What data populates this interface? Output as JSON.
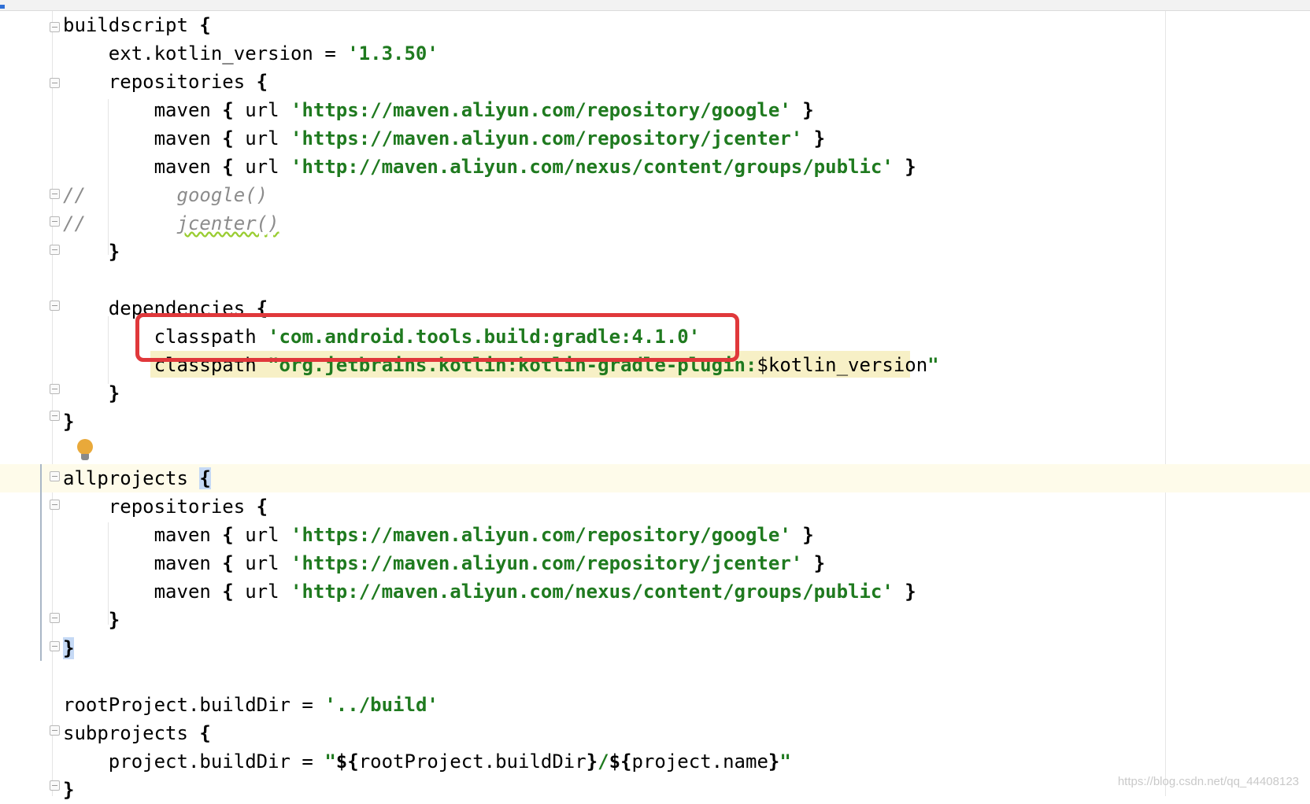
{
  "editor": {
    "lines": [
      {
        "id": "l1",
        "t1": "buildscript ",
        "b": "{"
      },
      {
        "id": "l2",
        "t1": "    ext.kotlin_version = ",
        "s": "'1.3.50'"
      },
      {
        "id": "l3",
        "t1": "    repositories ",
        "b": "{"
      },
      {
        "id": "l4",
        "t1": "        maven ",
        "b1": "{",
        "t2": " url ",
        "s": "'https://maven.aliyun.com/repository/google'",
        "b2": "}"
      },
      {
        "id": "l5",
        "t1": "        maven ",
        "b1": "{",
        "t2": " url ",
        "s": "'https://maven.aliyun.com/repository/jcenter'",
        "b2": "}"
      },
      {
        "id": "l6",
        "t1": "        maven ",
        "b1": "{",
        "t2": " url ",
        "s": "'http://maven.aliyun.com/nexus/content/groups/public'",
        "b2": "}"
      },
      {
        "id": "l7",
        "c1": "//",
        "c2": "google()"
      },
      {
        "id": "l8",
        "c1": "//",
        "c2": "jcenter()"
      },
      {
        "id": "l9",
        "t1": "    ",
        "b": "}"
      },
      {
        "id": "l10",
        "t1": "    dependencies ",
        "b": "{"
      },
      {
        "id": "l11",
        "t1": "        classpath ",
        "s": "'com.android.tools.build:gradle:4.1.0'"
      },
      {
        "id": "l12",
        "t1": "        classpath ",
        "s": "\"org.jetbrains.kotlin:kotlin-gradle-plugin:",
        "t2": "$kotlin_version",
        "s2": "\""
      },
      {
        "id": "l13",
        "t1": "    ",
        "b": "}"
      },
      {
        "id": "l14",
        "b": "}"
      },
      {
        "id": "l15",
        "t1": "allprojects ",
        "b": "{"
      },
      {
        "id": "l16",
        "t1": "    repositories ",
        "b": "{"
      },
      {
        "id": "l17",
        "t1": "        maven ",
        "b1": "{",
        "t2": " url ",
        "s": "'https://maven.aliyun.com/repository/google'",
        "b2": "}"
      },
      {
        "id": "l18",
        "t1": "        maven ",
        "b1": "{",
        "t2": " url ",
        "s": "'https://maven.aliyun.com/repository/jcenter'",
        "b2": "}"
      },
      {
        "id": "l19",
        "t1": "        maven ",
        "b1": "{",
        "t2": " url ",
        "s": "'http://maven.aliyun.com/nexus/content/groups/public'",
        "b2": "}"
      },
      {
        "id": "l20",
        "t1": "    ",
        "b": "}"
      },
      {
        "id": "l21",
        "b": "}"
      },
      {
        "id": "l22",
        "t1": "rootProject.buildDir = ",
        "s": "'../build'"
      },
      {
        "id": "l23",
        "t1": "subprojects ",
        "b": "{"
      },
      {
        "id": "l24",
        "t1": "    project.buildDir = ",
        "q1": "\"",
        "b1": "${",
        "t2": "rootProject.buildDir",
        "b2": "}",
        "t3": "/",
        "b3": "${",
        "t4": "project.name",
        "b4": "}",
        "q2": "\""
      },
      {
        "id": "l25",
        "b": "}"
      }
    ]
  },
  "watermark": "https://blog.csdn.net/qq_44408123",
  "colors": {
    "string": "#1f7a1f",
    "comment": "#8c8c8c",
    "callout": "#e0383b",
    "caret_row": "#fefbea",
    "bulb": "#e9a93a"
  },
  "icons": [
    "intention-bulb-icon",
    "fold-marker-icon"
  ]
}
